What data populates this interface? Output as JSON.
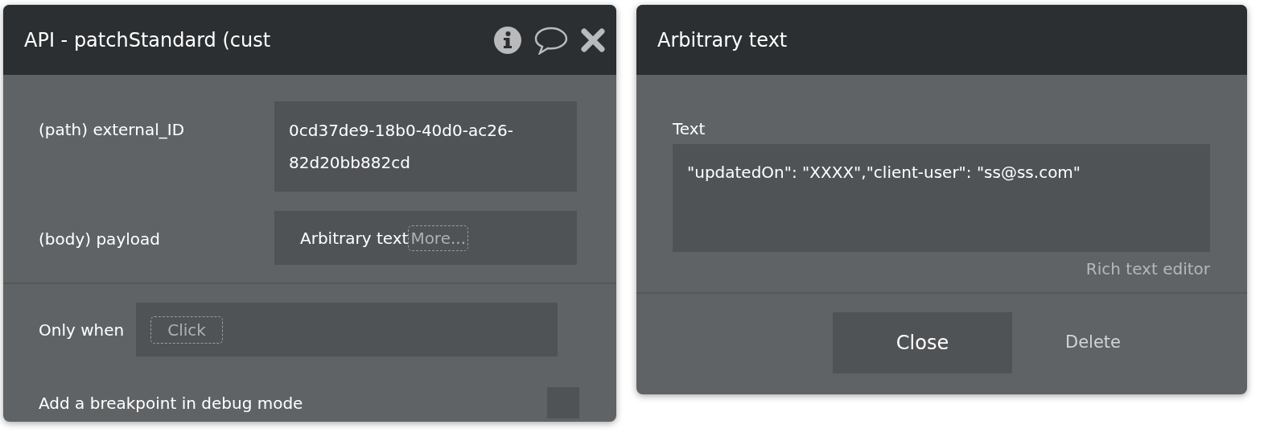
{
  "action_panel": {
    "title": "API - patchStandard (cust",
    "fields": [
      {
        "label": "(path) external_ID",
        "kind": "value",
        "value": "0cd37de9-18b0-40d0-ac26-82d20bb882cd"
      },
      {
        "label": "(body) payload",
        "kind": "expression",
        "value": "Arbitrary text",
        "more": "More..."
      }
    ],
    "only_when": {
      "label": "Only when",
      "placeholder": "Click"
    },
    "breakpoint": {
      "label": "Add a breakpoint in debug mode",
      "checked": false
    }
  },
  "text_panel": {
    "title": "Arbitrary text",
    "field_label": "Text",
    "value": "\"updatedOn\": \"XXXX\",\"client-user\": \"ss@ss.com\"",
    "editor_link": "Rich text editor",
    "buttons": [
      {
        "label": "Close",
        "kind": "primary"
      },
      {
        "label": "Delete",
        "kind": "link"
      }
    ]
  }
}
